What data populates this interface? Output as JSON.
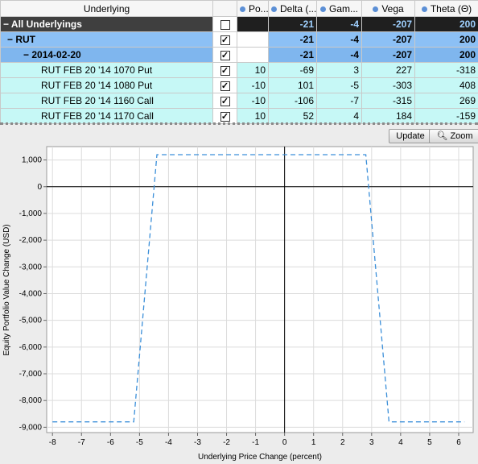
{
  "table": {
    "headers": [
      "Underlying",
      "",
      "Po...",
      "Delta (...",
      "Gam...",
      "Vega",
      "Theta (Θ)"
    ],
    "rows": [
      {
        "label": "All Underlyings",
        "checked": true,
        "pos": "",
        "delta": "-21",
        "gamma": "-4",
        "vega": "-207",
        "theta": "200"
      },
      {
        "label": "RUT",
        "checked": true,
        "pos": "",
        "delta": "-21",
        "gamma": "-4",
        "vega": "-207",
        "theta": "200"
      },
      {
        "label": "2014-02-20",
        "checked": true,
        "pos": "",
        "delta": "-21",
        "gamma": "-4",
        "vega": "-207",
        "theta": "200"
      },
      {
        "label": "RUT FEB 20 '14 1070 Put",
        "checked": true,
        "pos": "10",
        "delta": "-69",
        "gamma": "3",
        "vega": "227",
        "theta": "-318"
      },
      {
        "label": "RUT FEB 20 '14 1080 Put",
        "checked": true,
        "pos": "-10",
        "delta": "101",
        "gamma": "-5",
        "vega": "-303",
        "theta": "408"
      },
      {
        "label": "RUT FEB 20 '14 1160 Call",
        "checked": true,
        "pos": "-10",
        "delta": "-106",
        "gamma": "-7",
        "vega": "-315",
        "theta": "269"
      },
      {
        "label": "RUT FEB 20 '14 1170 Call",
        "checked": true,
        "pos": "10",
        "delta": "52",
        "gamma": "4",
        "vega": "184",
        "theta": "-159"
      }
    ]
  },
  "toolbar": {
    "update_label": "Update",
    "zoom_label": "Zoom",
    "zoom_icon": "magnifier-icon"
  },
  "chart_data": {
    "type": "line",
    "xlabel": "Underlying Price Change (percent)",
    "ylabel": "Equity Portfolio Value Change (USD)",
    "xlim": [
      -8.2,
      6.5
    ],
    "ylim": [
      -9200,
      1500
    ],
    "xticks": [
      -8,
      -7,
      -6,
      -5,
      -4,
      -3,
      -2,
      -1,
      0,
      1,
      2,
      3,
      4,
      5,
      6
    ],
    "yticks": [
      1000,
      0,
      -1000,
      -2000,
      -3000,
      -4000,
      -5000,
      -6000,
      -7000,
      -8000,
      -9000
    ],
    "ytick_labels": [
      "1,000",
      "0",
      "-1,000",
      "-2,000",
      "-3,000",
      "-4,000",
      "-5,000",
      "-6,000",
      "-7,000",
      "-8,000",
      "-9,000"
    ],
    "grid": true,
    "series_color": "#3b8fd9",
    "x": [
      -8.0,
      -5.2,
      -4.4,
      2.8,
      3.6,
      6.2
    ],
    "y": [
      -8800,
      -8800,
      1200,
      1200,
      -8800,
      -8800
    ]
  }
}
